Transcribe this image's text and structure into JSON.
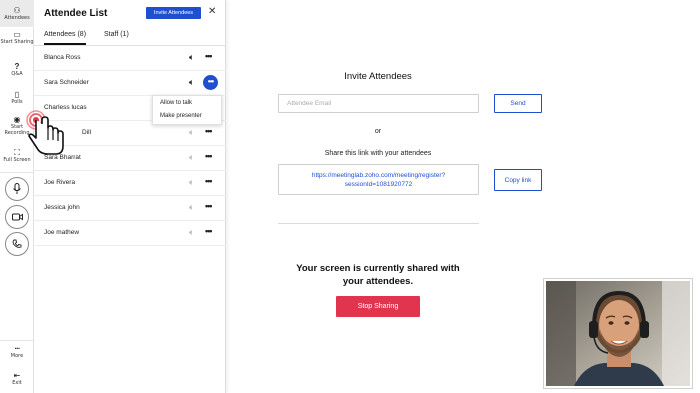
{
  "rail": {
    "attendees": "Attendees",
    "start_sharing": "Start Sharing",
    "qa": "Q&A",
    "polls": "Polls",
    "start_recording": "Start Recording",
    "full_screen": "Full Screen",
    "more": "More",
    "exit": "Exit"
  },
  "panel": {
    "title": "Attendee List",
    "invite_button": "Invite Attendees",
    "tabs": [
      "Attendees (8)",
      "Staff (1)"
    ],
    "attendees": [
      "Blanca Ross",
      "Sara Schneider",
      "Charless lucas",
      "Dill",
      "Sara Bharrat",
      "Joe Rivera",
      "Jessica john",
      "Joe mathew"
    ],
    "menu": [
      "Allow to talk",
      "Make presenter"
    ]
  },
  "invite": {
    "heading": "Invite Attendees",
    "email_placeholder": "Attendee Email",
    "send": "Send",
    "or": "or",
    "share_text": "Share this link with your attendees",
    "link_line1": "https://meetinglab.zoho.com/meeting/register?",
    "link_line2": "sessionId=1081920772",
    "copy": "Copy link"
  },
  "sharing": {
    "line1": "Your screen is currently shared with",
    "line2": "your attendees.",
    "stop": "Stop Sharing"
  },
  "colors": {
    "accent": "#1f4fd1",
    "stop": "#e0344f",
    "pointer_ring": "#e53946"
  }
}
